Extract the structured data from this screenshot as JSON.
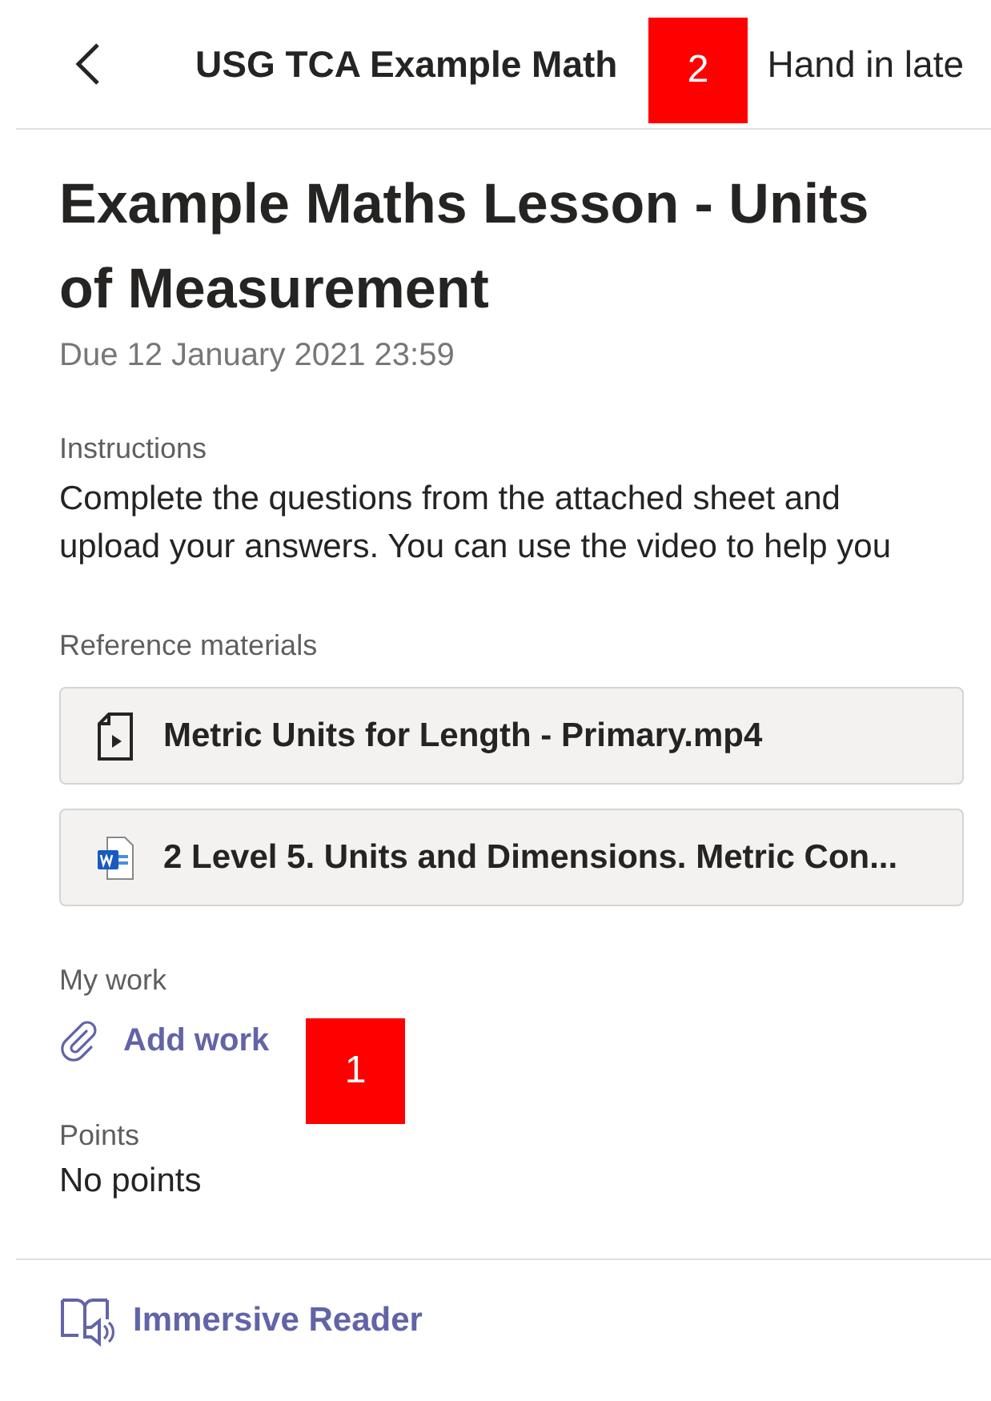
{
  "header": {
    "title": "USG TCA Example Math",
    "action": "Hand in late"
  },
  "assignment": {
    "title": "Example Maths Lesson - Units of Measurement",
    "due": "Due 12 January 2021 23:59"
  },
  "instructions": {
    "label": "Instructions",
    "text": "Complete the questions from the attached sheet and upload your answers. You can use the video to help you"
  },
  "reference": {
    "label": "Reference materials",
    "files": [
      {
        "kind": "video",
        "name": "Metric Units for Length - Primary.mp4"
      },
      {
        "kind": "word",
        "name": "2 Level 5. Units and Dimensions. Metric Con..."
      }
    ]
  },
  "my_work": {
    "label": "My work",
    "action": "Add work"
  },
  "points": {
    "label": "Points",
    "value": "No points"
  },
  "footer": {
    "action": "Immersive Reader"
  },
  "annotations": [
    {
      "label": "1"
    },
    {
      "label": "2"
    }
  ]
}
